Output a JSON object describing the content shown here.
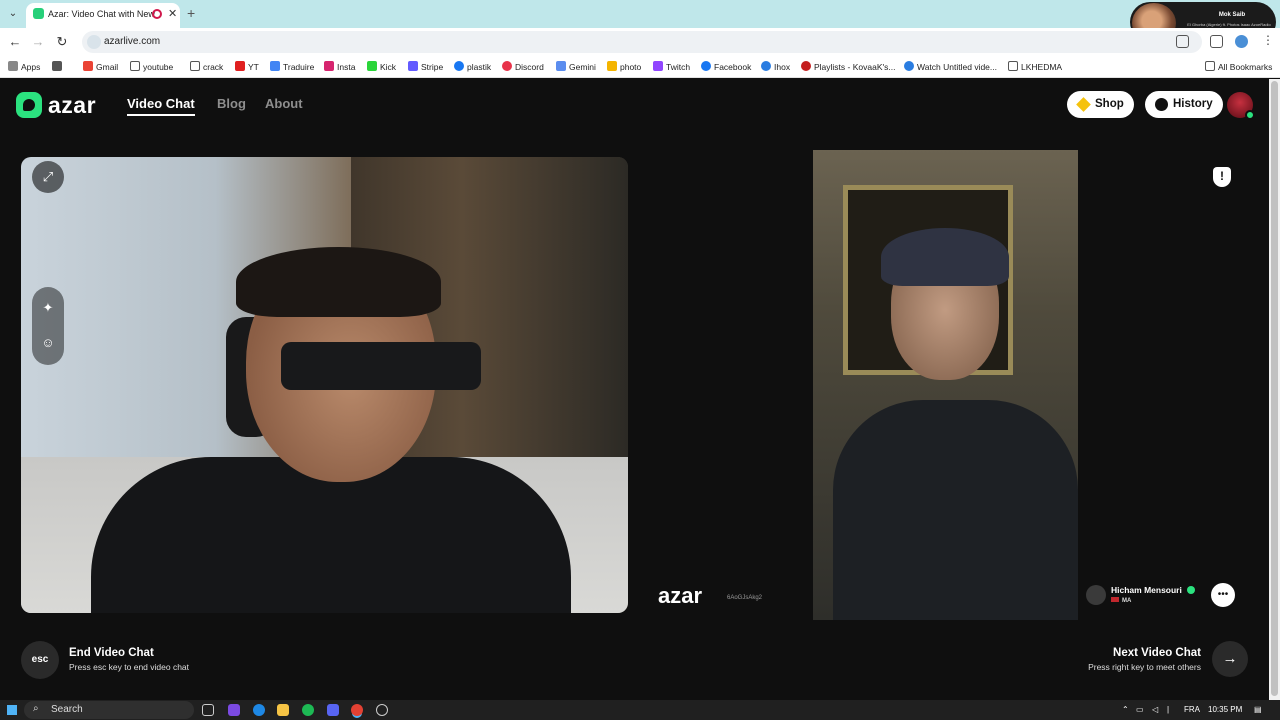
{
  "browser": {
    "tab_title": "Azar: Video Chat with New",
    "url": "azarlive.com",
    "bookmarks": [
      "Apps",
      "Gmail",
      "youtube",
      "crack",
      "YT",
      "Traduire",
      "Insta",
      "Kick",
      "Stripe",
      "plastik",
      "Discord",
      "Gemini",
      "photo",
      "Twitch",
      "Facebook",
      "Ihox",
      "Playlists - KovaaK's...",
      "Watch Untitled vide...",
      "LKHEDMA"
    ],
    "all_bookmarks": "All Bookmarks",
    "profile_popup": {
      "title": "Mok Saib",
      "subtitle": "El Ghorba (Algerie) ft. Photos Isaac AzoeRadio"
    }
  },
  "site": {
    "logo_text": "azar",
    "nav": [
      "Video Chat",
      "Blog",
      "About"
    ],
    "shop_label": "Shop",
    "history_label": "History",
    "brand_color": "#2be27f"
  },
  "remote": {
    "logo_text": "azar",
    "code": "6AoGJsAkg2",
    "partner_name": "Hicham Mensouri",
    "partner_country": "MA"
  },
  "controls": {
    "esc_key": "esc",
    "end_title": "End Video Chat",
    "end_sub": "Press esc key to end video chat",
    "next_title": "Next Video Chat",
    "next_sub": "Press right key to meet others"
  },
  "taskbar": {
    "search_label": "Search",
    "lang": "FRA",
    "time": "10:35 PM"
  }
}
